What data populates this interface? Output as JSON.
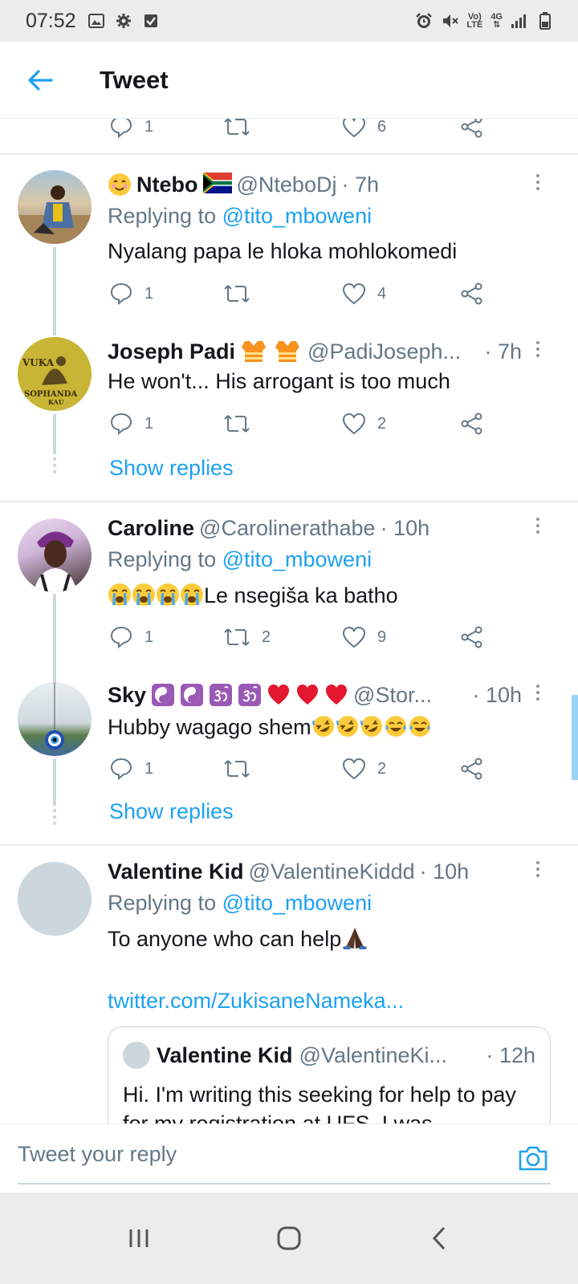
{
  "status_bar": {
    "time": "07:52",
    "network_top": "Vo)",
    "network_bottom": "LTE",
    "net_type": "4G"
  },
  "header": {
    "title": "Tweet"
  },
  "top_partial": {
    "reply_count": "1",
    "like_count": "6"
  },
  "tweets": [
    {
      "name": "Ntebo",
      "handle": "@NteboDj",
      "time": "· 7h",
      "replying_prefix": "Replying to ",
      "replying_to": "@tito_mboweni",
      "text": "Nyalang papa le hloka mohlokomedi",
      "reply_count": "1",
      "retweet_count": "",
      "like_count": "4"
    },
    {
      "name": "Joseph Padi",
      "handle": "@PadiJoseph...",
      "time": "· 7h",
      "text": "He won't... His arrogant is too much",
      "reply_count": "1",
      "retweet_count": "",
      "like_count": "2",
      "avatar_text_top": "VUKA",
      "avatar_text_bottom": "SOPHANDA",
      "avatar_text_bottom2": "KAU",
      "show_replies": "Show replies"
    },
    {
      "name": "Caroline",
      "handle": "@Carolinerathabe",
      "time": "· 10h",
      "replying_prefix": "Replying to ",
      "replying_to": "@tito_mboweni",
      "text": "Le nsegiša ka batho",
      "reply_count": "1",
      "retweet_count": "2",
      "like_count": "9"
    },
    {
      "name": "Sky",
      "handle": "@Stor...",
      "time": "· 10h",
      "text": "Hubby wagago shem",
      "reply_count": "1",
      "retweet_count": "",
      "like_count": "2",
      "show_replies": "Show replies"
    },
    {
      "name": "Valentine Kid",
      "handle": "@ValentineKiddd",
      "time": "· 10h",
      "replying_prefix": "Replying to ",
      "replying_to": "@tito_mboweni",
      "text": "To anyone who can help",
      "link": "twitter.com/ZukisaneNameka...",
      "quote": {
        "name": "Valentine Kid",
        "handle": "@ValentineKi...",
        "time": "· 12h",
        "text": "Hi. I'm writing this seeking for help to pay for my registration at UFS. I was"
      }
    }
  ],
  "compose": {
    "placeholder": "Tweet your reply"
  },
  "colors": {
    "accent": "#1da1f2",
    "secondary_text": "#657786",
    "divider": "#e6ecf0"
  }
}
